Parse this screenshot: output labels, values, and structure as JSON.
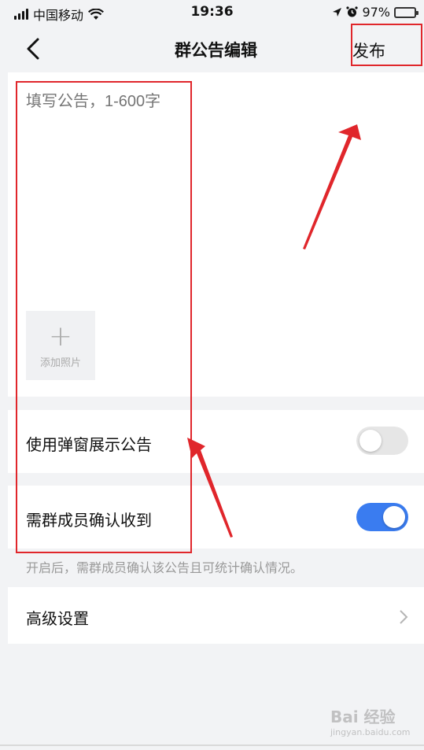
{
  "status_bar": {
    "carrier": "中国移动",
    "time": "19:36",
    "battery": "97%"
  },
  "nav": {
    "title": "群公告编辑",
    "publish_label": "发布"
  },
  "editor": {
    "placeholder": "填写公告，1-600字",
    "add_photo_label": "添加照片"
  },
  "settings": {
    "popup_label": "使用弹窗展示公告",
    "popup_enabled": false,
    "confirm_label": "需群成员确认收到",
    "confirm_enabled": true,
    "confirm_hint": "开启后，需群成员确认该公告且可统计确认情况。",
    "advanced_label": "高级设置"
  },
  "watermark": {
    "brand": "Bai 经验",
    "url": "jingyan.baidu.com"
  },
  "colors": {
    "accent": "#3a7cf0",
    "toggle_off": "#e6e6e6",
    "annotation": "#e0262b"
  }
}
